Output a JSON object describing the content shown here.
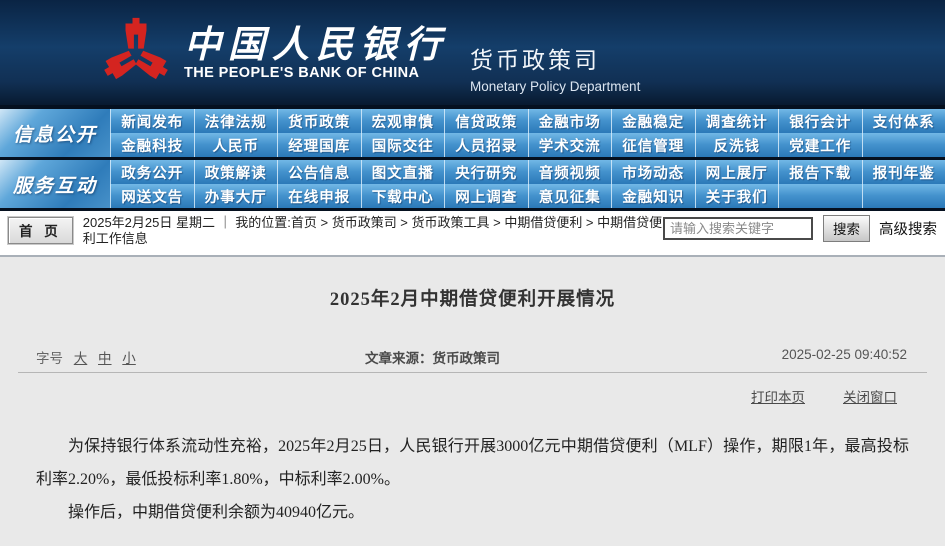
{
  "header": {
    "bank_name_cn": "中国人民银行",
    "bank_name_en": "THE PEOPLE'S BANK OF CHINA",
    "dept_cn": "货币政策司",
    "dept_en": "Monetary Policy Department",
    "logo_color": "#d42420"
  },
  "nav": {
    "sections": [
      {
        "label": "信息公开",
        "rows": [
          [
            "新闻发布",
            "法律法规",
            "货币政策",
            "宏观审慎",
            "信贷政策",
            "金融市场",
            "金融稳定",
            "调查统计",
            "银行会计",
            "支付体系"
          ],
          [
            "金融科技",
            "人民币",
            "经理国库",
            "国际交往",
            "人员招录",
            "学术交流",
            "征信管理",
            "反洗钱",
            "党建工作",
            ""
          ]
        ]
      },
      {
        "label": "服务互动",
        "rows": [
          [
            "政务公开",
            "政策解读",
            "公告信息",
            "图文直播",
            "央行研究",
            "音频视频",
            "市场动态",
            "网上展厅",
            "报告下载",
            "报刊年鉴"
          ],
          [
            "网送文告",
            "办事大厅",
            "在线申报",
            "下载中心",
            "网上调查",
            "意见征集",
            "金融知识",
            "关于我们",
            "",
            ""
          ]
        ]
      }
    ]
  },
  "breadcrumb": {
    "home_button": "首 页",
    "date": "2025年2月25日 星期二",
    "separator": "｜",
    "location": "我的位置:首页 > 货币政策司 > 货币政策工具 > 中期借贷便利 > 中期借贷便利工作信息",
    "search_placeholder": "请输入搜索关键字",
    "search_button": "搜索",
    "advanced_search": "高级搜索"
  },
  "article": {
    "title": "2025年2月中期借贷便利开展情况",
    "font_size_label": "字号",
    "font_sizes": [
      "大",
      "中",
      "小"
    ],
    "source_label": "文章来源：货币政策司",
    "timestamp": "2025-02-25 09:40:52",
    "print_link": "打印本页",
    "close_link": "关闭窗口",
    "paragraphs": [
      "为保持银行体系流动性充裕，2025年2月25日，人民银行开展3000亿元中期借贷便利（MLF）操作，期限1年，最高投标利率2.20%，最低投标利率1.80%，中标利率2.00%。",
      "操作后，中期借贷便利余额为40940亿元。"
    ]
  },
  "colors": {
    "header_navy": "#143e6a",
    "nav_blue_top": "#72b8e6",
    "nav_blue_bottom": "#2b79b8",
    "content_bg": "#e9e9e9",
    "logo_red": "#d42420"
  }
}
